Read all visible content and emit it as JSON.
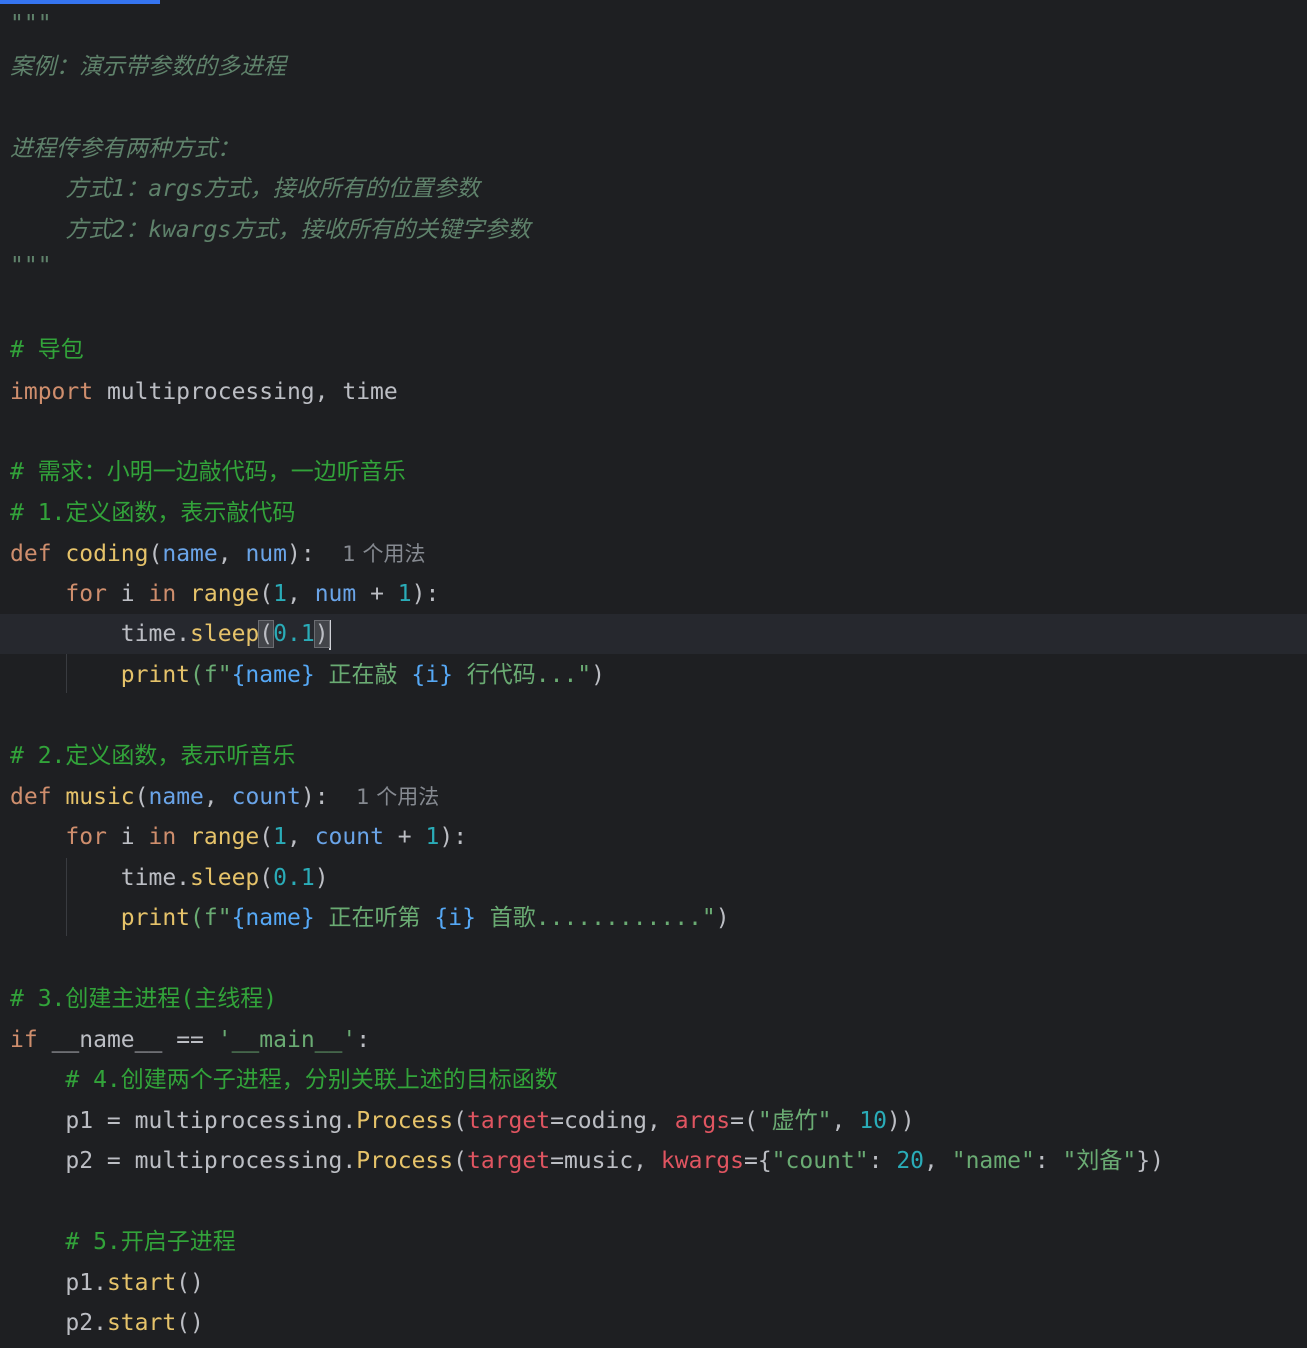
{
  "docstring": {
    "open": "\"\"\"",
    "line1": "案例：演示带参数的多进程",
    "line2": "进程传参有两种方式：",
    "line3": "    方式1：args方式，接收所有的位置参数",
    "line4": "    方式2：kwargs方式，接收所有的关键字参数",
    "close": "\"\"\""
  },
  "comments": {
    "c1": "# 导包",
    "c2": "# 需求：小明一边敲代码，一边听音乐",
    "c3": "# 1.定义函数，表示敲代码",
    "c4": "# 2.定义函数，表示听音乐",
    "c5": "# 3.创建主进程(主线程)",
    "c6": "# 4.创建两个子进程，分别关联上述的目标函数",
    "c7": "# 5.开启子进程"
  },
  "code": {
    "import_kw": "import",
    "import_rest": " multiprocessing, time",
    "def_kw": "def",
    "coding_name": "coding",
    "coding_params_open": "(",
    "p_name": "name",
    "comma": ", ",
    "p_num": "num",
    "coding_params_close": "): ",
    "usage_hint": "1 个用法",
    "for_kw": "for",
    "i_var": " i ",
    "in_kw": "in",
    "range_fn": " range",
    "range1_open": "(",
    "n1": "1",
    "num_plus": "num",
    "plus": " + ",
    "range1_close": "):",
    "time_sleep_obj": "time.",
    "sleep_fn": "sleep",
    "sleep_open": "(",
    "sleep_arg": "0.1",
    "sleep_close": ")",
    "print_fn": "print",
    "print1_open": "(f\"",
    "brace_name": "{name}",
    "print1_mid": " 正在敲 ",
    "brace_i": "{i}",
    "print1_tail": " 行代码...\"",
    "print_close": ")",
    "music_name": "music",
    "p_count": "count",
    "print2_mid": " 正在听第 ",
    "print2_tail": " 首歌............\"",
    "if_kw": "if",
    "main_check_a": " ",
    "dunder_name": "__name__",
    "eqeq": " == ",
    "main_str": "'__main__'",
    "colon": ":",
    "p1_lhs": "p1 = multiprocessing.",
    "process_cls": "Process",
    "paren_open": "(",
    "target_kw": "target",
    "eq": "=",
    "coding_ref": "coding, ",
    "args_kw": "args",
    "args_val_open": "=(",
    "args_str": "\"虚竹\"",
    "n10": "10",
    "args_close": "))",
    "p2_lhs": "p2 = multiprocessing.",
    "music_ref": "music, ",
    "kwargs_kw": "kwargs",
    "kwargs_open": "={",
    "count_key": "\"count\"",
    "colon_sp": ": ",
    "n20": "20",
    "name_key": "\"name\"",
    "liubei": "\"刘备\"",
    "kwargs_close": "})",
    "p1_obj": "p1.",
    "p2_obj": "p2.",
    "start_fn": "start",
    "call_parens": "()"
  }
}
